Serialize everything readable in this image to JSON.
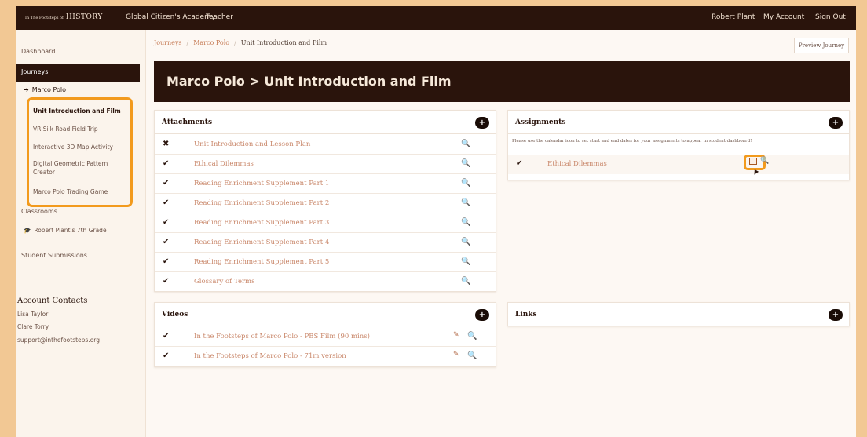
{
  "topbar": {
    "logo_prefix": "In The Footsteps of",
    "logo_main": "HISTORY",
    "org": "Global Citizen's Academy",
    "role": "Teacher",
    "user": "Robert Plant",
    "my_account": "My Account",
    "sign_out": "Sign Out"
  },
  "sidebar": {
    "dashboard": "Dashboard",
    "journeys": "Journeys",
    "journey": "Marco Polo",
    "activities": [
      "Unit Introduction and Film",
      "VR Silk Road Field Trip",
      "Interactive 3D Map Activity",
      "Digital Geometric Pattern Creator",
      "Marco Polo Trading Game"
    ],
    "classrooms": "Classrooms",
    "classroom": "Robert Plant's 7th Grade",
    "submissions": "Student Submissions",
    "contacts_heading": "Account Contacts",
    "contacts": [
      "Lisa Taylor",
      "Clare Torry",
      "support@inthefootsteps.org"
    ]
  },
  "breadcrumb": {
    "journeys": "Journeys",
    "journey": "Marco Polo",
    "current": "Unit Introduction and Film"
  },
  "preview_button": "Preview Journey",
  "page_title": "Marco Polo > Unit Introduction and Film",
  "attachments": {
    "title": "Attachments",
    "rows": [
      {
        "mark": "✖",
        "label": "Unit Introduction and Lesson Plan"
      },
      {
        "mark": "✔",
        "label": "Ethical Dilemmas"
      },
      {
        "mark": "✔",
        "label": "Reading Enrichment Supplement Part 1"
      },
      {
        "mark": "✔",
        "label": "Reading Enrichment Supplement Part 2"
      },
      {
        "mark": "✔",
        "label": "Reading Enrichment Supplement Part 3"
      },
      {
        "mark": "✔",
        "label": "Reading Enrichment Supplement Part 4"
      },
      {
        "mark": "✔",
        "label": "Reading Enrichment Supplement Part 5"
      },
      {
        "mark": "✔",
        "label": "Glossary of Terms"
      }
    ]
  },
  "assignments": {
    "title": "Assignments",
    "note": "Please use the calendar icon  to set start and end dates for your assignments to appear in student dashboard!",
    "rows": [
      {
        "mark": "✔",
        "label": "Ethical Dilemmas"
      }
    ]
  },
  "videos": {
    "title": "Videos",
    "rows": [
      {
        "mark": "✔",
        "label": "In the Footsteps of Marco Polo - PBS Film (90 mins)"
      },
      {
        "mark": "✔",
        "label": "In the Footsteps of Marco Polo - 71m version"
      }
    ]
  },
  "links": {
    "title": "Links"
  },
  "icons": {
    "plus": "+",
    "search": "🔍",
    "edit": "✎"
  }
}
